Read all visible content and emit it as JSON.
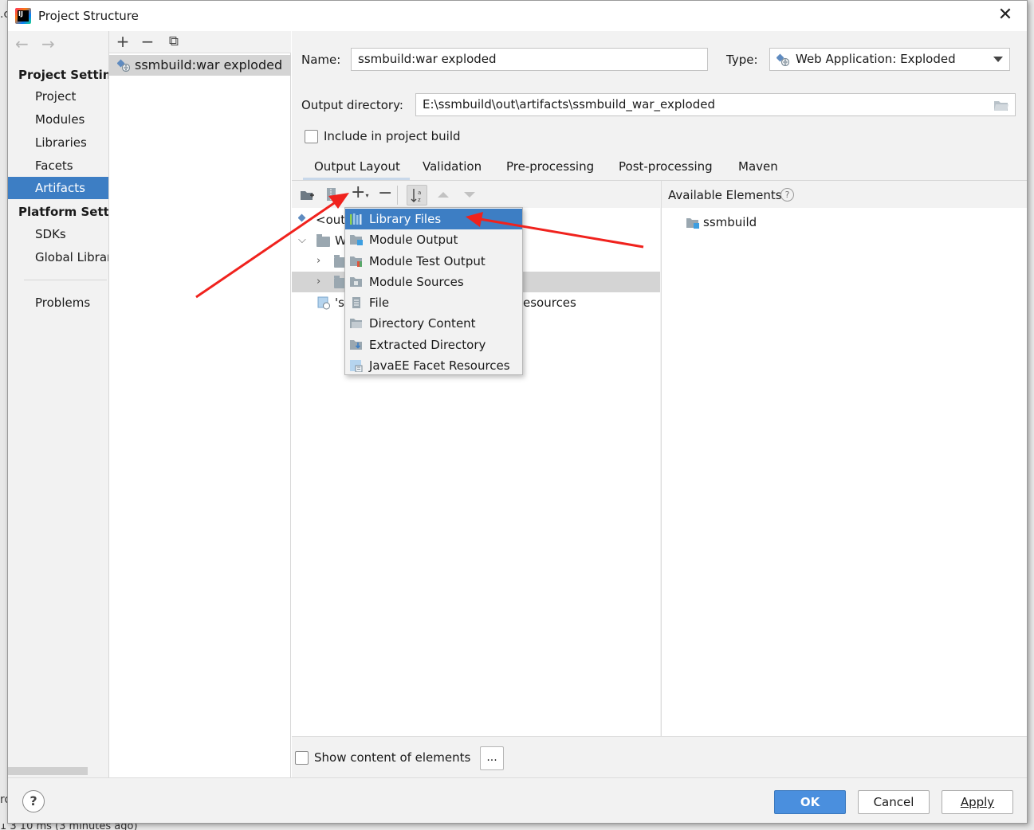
{
  "background": {
    "left_fragments": [
      ".c",
      "ro"
    ],
    "bottom_fragment": "1 3 10 ms (3 minutes ago)"
  },
  "window": {
    "title": "Project Structure",
    "close_glyph": "✕"
  },
  "sidebar": {
    "back_glyph": "←",
    "forward_glyph": "→",
    "project_settings_header": "Project Setting",
    "project_items": [
      "Project",
      "Modules",
      "Libraries",
      "Facets",
      "Artifacts"
    ],
    "selected": "Artifacts",
    "platform_settings_header": "Platform Settin",
    "platform_items": [
      "SDKs",
      "Global Librar"
    ],
    "problems": "Problems"
  },
  "artifact_list": {
    "toolbar": {
      "add": "+",
      "remove": "−",
      "copy": "⧉"
    },
    "items": [
      "ssmbuild:war exploded"
    ]
  },
  "artifact": {
    "name_label": "Name:",
    "name_value": "ssmbuild:war exploded",
    "type_label": "Type:",
    "type_value": "Web Application: Exploded",
    "output_dir_label": "Output directory:",
    "output_dir_value": "E:\\ssmbuild\\out\\artifacts\\ssmbuild_war_exploded",
    "include_label": "Include in project build",
    "include_checked": false
  },
  "tabs": [
    "Output Layout",
    "Validation",
    "Pre-processing",
    "Post-processing",
    "Maven"
  ],
  "active_tab": "Output Layout",
  "layout_tree": {
    "rows": [
      "<out",
      "W",
      "",
      "",
      "'s"
    ],
    "resources_fragment": "esources"
  },
  "available_elements": {
    "header": "Available Elements",
    "help_glyph": "?",
    "items": [
      "ssmbuild"
    ]
  },
  "add_menu": {
    "items": [
      "Library Files",
      "Module Output",
      "Module Test Output",
      "Module Sources",
      "File",
      "Directory Content",
      "Extracted Directory",
      "JavaEE Facet Resources"
    ],
    "selected": "Library Files"
  },
  "show_content": {
    "label": "Show content of elements",
    "checked": false,
    "ellipsis": "..."
  },
  "footer": {
    "help": "?",
    "ok": "OK",
    "cancel": "Cancel",
    "apply": "Apply"
  },
  "colors": {
    "selection": "#3d7ec4",
    "annotation_arrow": "#f0221d",
    "primary_button": "#4a8fde"
  }
}
